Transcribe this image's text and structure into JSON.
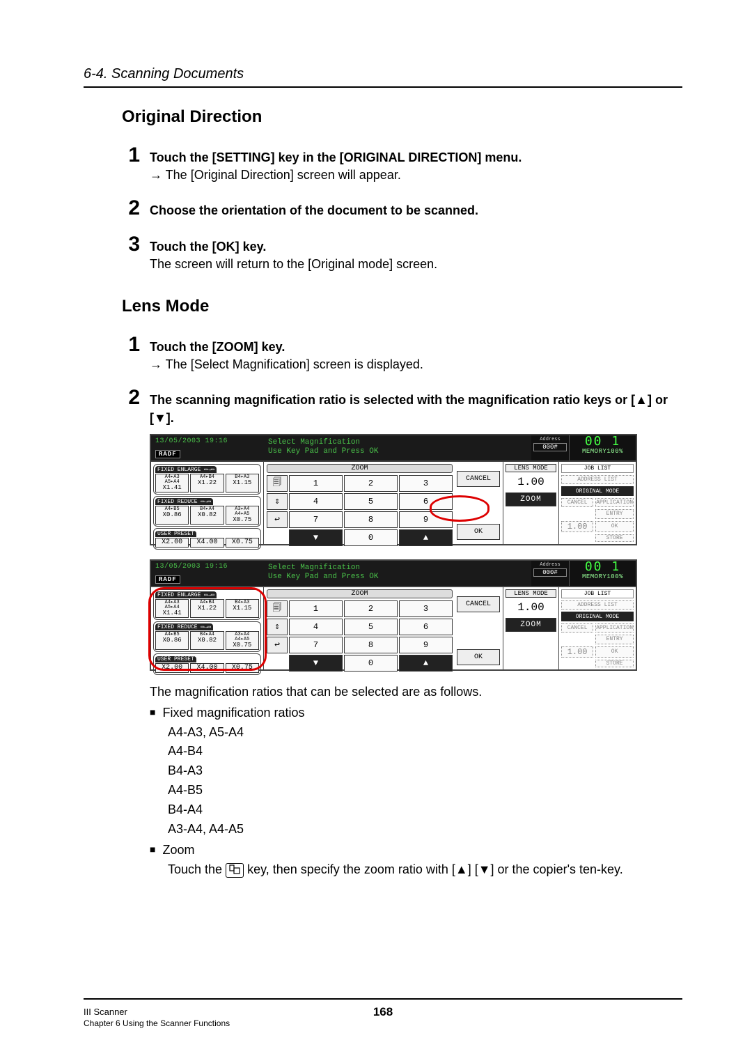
{
  "breadcrumb": "6-4. Scanning Documents",
  "h_original": "Original Direction",
  "steps_or": [
    {
      "num": "1",
      "bold": "Touch the [SETTING] key in the [ORIGINAL DIRECTION] menu.",
      "line": "→ The [Original Direction] screen will appear."
    },
    {
      "num": "2",
      "bold": "Choose the orientation of the document to be scanned."
    },
    {
      "num": "3",
      "bold": "Touch the [OK] key.",
      "line": "The screen will return to the [Original mode] screen."
    }
  ],
  "h_lens": "Lens Mode",
  "steps_lens": [
    {
      "num": "1",
      "bold": "Touch the [ZOOM] key.",
      "line": "→ The [Select Magnification] screen is displayed."
    },
    {
      "num": "2",
      "bold": "The scanning magnification ratio is selected with the magnification ratio keys or  [▲] or [▼]."
    }
  ],
  "panel": {
    "datetime": "13/05/2003 19:16",
    "radf": "RADF",
    "mid1": "Select Magnification",
    "mid2": "Use Key Pad and Press OK",
    "address_lbl": "Address",
    "address_val": "000#",
    "seg": "00 1",
    "memory": "MEMORY100%",
    "enlarge_title": "FIXED ENLARGE ▭→▭",
    "enlarge": [
      {
        "t1": "A4▸A3",
        "t1b": "A5▸A4",
        "t2": "X1.41"
      },
      {
        "t1": "A4▸B4",
        "t2": "X1.22"
      },
      {
        "t1": "B4▸A3",
        "t2": "X1.15"
      }
    ],
    "reduce_title": "FIXED REDUCE ▭→▭",
    "reduce": [
      {
        "t1": "A4▸B5",
        "t2": "X0.86"
      },
      {
        "t1": "B4▸A4",
        "t2": "X0.82"
      },
      {
        "t1": "A3▸A4",
        "t1b": "A4▸A5",
        "t2": "X0.75"
      }
    ],
    "user_title": "USER PRESET",
    "user": [
      {
        "t2": "X2.00"
      },
      {
        "t2": "X4.00"
      },
      {
        "t2": "X0.75"
      }
    ],
    "zoom_label": "ZOOM",
    "keypad": [
      "1",
      "2",
      "3",
      "4",
      "5",
      "6",
      "7",
      "8",
      "9",
      "▼",
      "0",
      "▲"
    ],
    "icons": [
      "🗐",
      "⇕",
      "↩"
    ],
    "cancel": "CANCEL",
    "ok": "OK",
    "lens_mode": "LENS MODE",
    "lens_val": "1.00",
    "zoom_btn": "ZOOM",
    "right": {
      "joblist": "JOB LIST",
      "addr_list": "ADDRESS LIST",
      "orig_mode": "ORIGINAL MODE",
      "cancel": "CANCEL",
      "application": "APPLICATION",
      "entry": "ENTRY",
      "ok": "OK",
      "num": "1.00",
      "store": "STORE"
    }
  },
  "after_panel": "The magnification ratios that can be selected are as follows.",
  "fixed_label": "Fixed magnification ratios",
  "fixed_list": [
    "A4-A3, A5-A4",
    "A4-B4",
    "B4-A3",
    "A4-B5",
    "B4-A4",
    "A3-A4, A4-A5"
  ],
  "zoom_label": "Zoom",
  "zoom_sentence_a": "Touch the ",
  "zoom_sentence_b": " key, then specify the zoom ratio with [▲] [▼] or the copier's ten-key.",
  "footer": {
    "l1": "III Scanner",
    "l2": "Chapter 6 Using the Scanner Functions",
    "page": "168"
  }
}
